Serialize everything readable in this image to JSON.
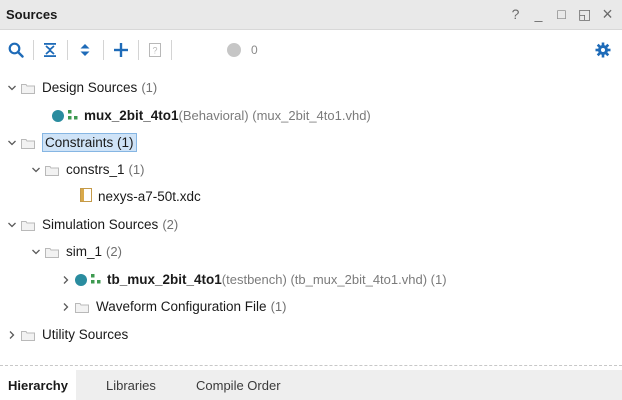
{
  "window": {
    "title": "Sources",
    "controls": {
      "help": "?",
      "minimize": "_",
      "restore": "□",
      "float": "◱",
      "close": "×"
    }
  },
  "toolbar": {
    "icons": [
      "search-icon",
      "collapse-all-icon",
      "expand-all-icon",
      "add-icon",
      "help-doc-icon",
      "status-dot-icon",
      "gear-icon"
    ],
    "status_count": "0"
  },
  "tree": {
    "design_sources": {
      "label": "Design Sources",
      "count": "(1)"
    },
    "design_top": {
      "name": "mux_2bit_4to1",
      "detail": "(Behavioral) (mux_2bit_4to1.vhd)"
    },
    "constraints": {
      "label": "Constraints (1)"
    },
    "constrs_1": {
      "label": "constrs_1",
      "count": "(1)"
    },
    "xdc_file": {
      "label": "nexys-a7-50t.xdc"
    },
    "simulation_sources": {
      "label": "Simulation Sources",
      "count": "(2)"
    },
    "sim_1": {
      "label": "sim_1",
      "count": "(2)"
    },
    "tb_top": {
      "name": "tb_mux_2bit_4to1",
      "detail": "(testbench) (tb_mux_2bit_4to1.vhd) (1)"
    },
    "waveform": {
      "label": "Waveform Configuration File",
      "count": "(1)"
    },
    "utility_sources": {
      "label": "Utility Sources"
    }
  },
  "tabs": [
    {
      "label": "Hierarchy",
      "active": true
    },
    {
      "label": "Libraries",
      "active": false
    },
    {
      "label": "Compile Order",
      "active": false
    }
  ],
  "colors": {
    "accent_blue": "#1e6bb8",
    "teal_dot": "#2a8c9f",
    "hier_green": "#3d9a50",
    "selection": "#cfe3f7"
  }
}
